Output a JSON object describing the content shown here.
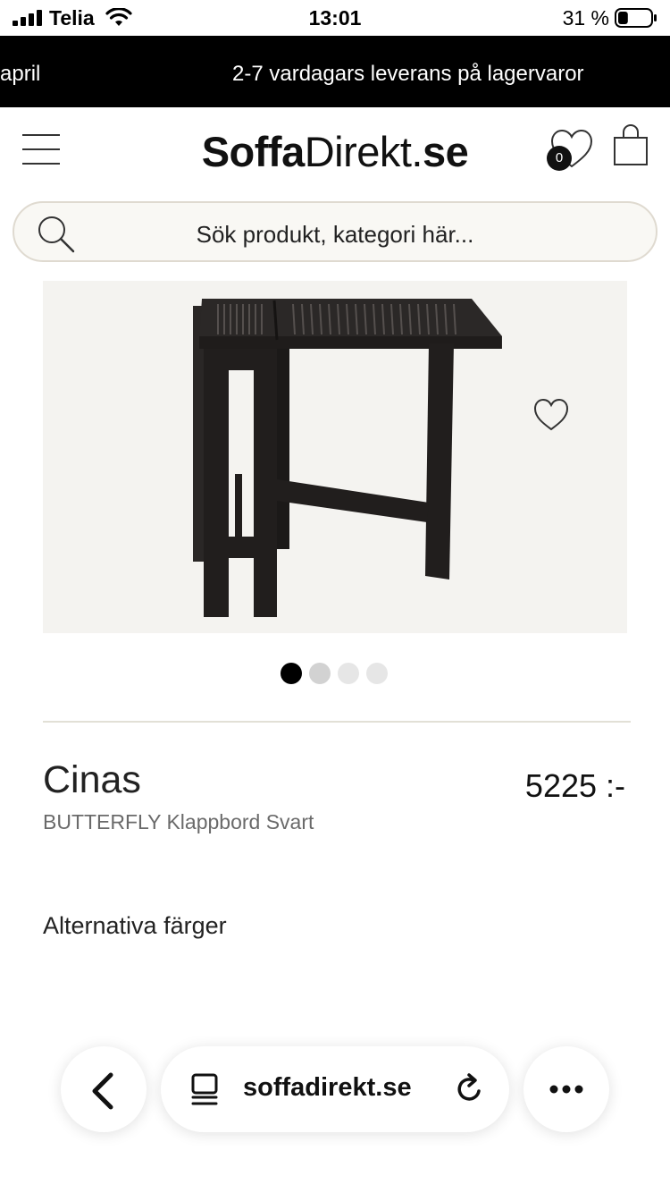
{
  "status_bar": {
    "carrier": "Telia",
    "time": "13:01",
    "battery_percent": "31 %",
    "battery_level": 0.31
  },
  "promo": {
    "text_left": "april",
    "text_right": "2-7 vardagars leverans på lagervaror"
  },
  "header": {
    "logo_part_bold": "Soffa",
    "logo_part_regular": "Direkt.",
    "logo_part_suffix": "se",
    "wishlist_count": "0",
    "search_placeholder": "Sök produkt, kategori här..."
  },
  "product": {
    "image_icon": "folding-table-image",
    "brand": "Cinas",
    "name": "BUTTERFLY Klappbord Svart",
    "price": "5225 :-",
    "alternative_colors_label": "Alternativa färger",
    "gallery_total": 4,
    "gallery_active": 1
  },
  "browser": {
    "url": "soffadirekt.se"
  },
  "colors": {
    "promo_bg": "#000000",
    "search_border": "#dfdad0",
    "image_bg": "#f4f3f0",
    "dot_active": "#000000",
    "dot_inactive": "#e2e2e2"
  }
}
